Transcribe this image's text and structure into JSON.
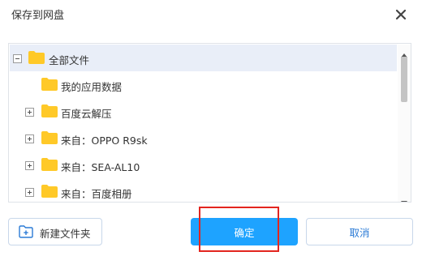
{
  "dialog": {
    "title": "保存到网盘"
  },
  "tree": {
    "items": [
      {
        "label": "全部文件",
        "expander": "minus"
      },
      {
        "label": "我的应用数据",
        "expander": "none"
      },
      {
        "label": "百度云解压",
        "expander": "plus"
      },
      {
        "label": "来自：OPPO R9sk",
        "expander": "plus"
      },
      {
        "label": "来自：SEA-AL10",
        "expander": "plus"
      },
      {
        "label": "来自：百度相册",
        "expander": "plus"
      }
    ]
  },
  "buttons": {
    "new_folder": "新建文件夹",
    "confirm": "确定",
    "cancel": "取消"
  },
  "colors": {
    "primary": "#1ea3ff",
    "highlight": "#e3251f",
    "folder": "#ffc928",
    "selected_row": "#e9eef8"
  },
  "icons": {
    "close": "close-icon",
    "folder": "folder-icon",
    "expand": "plus-square-icon",
    "collapse": "minus-square-icon",
    "new_folder": "folder-plus-icon"
  }
}
